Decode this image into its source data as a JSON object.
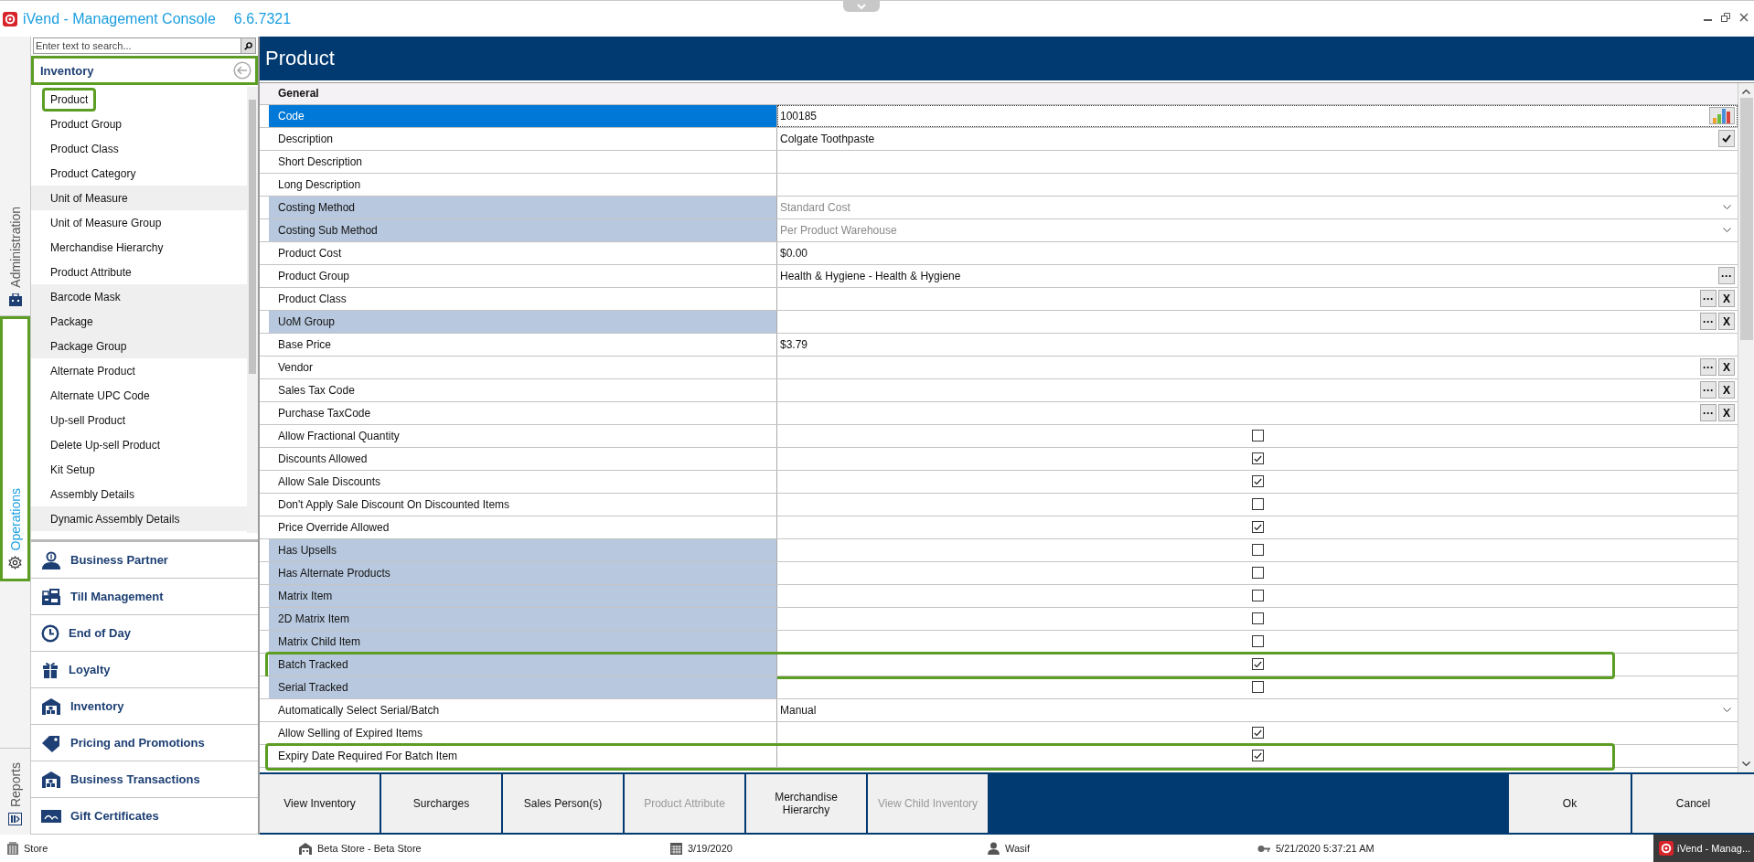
{
  "window": {
    "title": "iVend - Management Console",
    "version": "6.6.7321"
  },
  "side_tabs": [
    {
      "label": "Administration",
      "kind": "briefcase",
      "selected": false,
      "outlined": false
    },
    {
      "label": "Operations",
      "kind": "gear",
      "selected": true,
      "outlined": true
    },
    {
      "label": "Reports",
      "kind": "report",
      "selected": false,
      "outlined": false
    }
  ],
  "navigator": {
    "search": {
      "placeholder": "Enter text to search..."
    },
    "section": {
      "title": "Inventory",
      "outlined": true
    },
    "items": [
      {
        "label": "Product",
        "shaded": false,
        "outlined": true
      },
      {
        "label": "Product Group",
        "shaded": false,
        "outlined": false
      },
      {
        "label": "Product Class",
        "shaded": false,
        "outlined": false
      },
      {
        "label": "Product Category",
        "shaded": false,
        "outlined": false
      },
      {
        "label": "Unit of Measure",
        "shaded": true,
        "outlined": false
      },
      {
        "label": "Unit of Measure Group",
        "shaded": false,
        "outlined": false
      },
      {
        "label": "Merchandise Hierarchy",
        "shaded": false,
        "outlined": false
      },
      {
        "label": "Product Attribute",
        "shaded": false,
        "outlined": false
      },
      {
        "label": "Barcode Mask",
        "shaded": true,
        "outlined": false
      },
      {
        "label": "Package",
        "shaded": true,
        "outlined": false
      },
      {
        "label": "Package Group",
        "shaded": true,
        "outlined": false
      },
      {
        "label": "Alternate Product",
        "shaded": false,
        "outlined": false
      },
      {
        "label": "Alternate UPC Code",
        "shaded": false,
        "outlined": false
      },
      {
        "label": "Up-sell Product",
        "shaded": false,
        "outlined": false
      },
      {
        "label": "Delete Up-sell Product",
        "shaded": false,
        "outlined": false
      },
      {
        "label": "Kit Setup",
        "shaded": false,
        "outlined": false
      },
      {
        "label": "Assembly Details",
        "shaded": false,
        "outlined": false
      },
      {
        "label": "Dynamic Assembly Details",
        "shaded": true,
        "outlined": false
      }
    ]
  },
  "modules": [
    {
      "label": "Business Partner",
      "kind": "partner"
    },
    {
      "label": "Till Management",
      "kind": "register"
    },
    {
      "label": "End of Day",
      "kind": "clock"
    },
    {
      "label": "Loyalty",
      "kind": "gift"
    },
    {
      "label": "Inventory",
      "kind": "warehouse"
    },
    {
      "label": "Pricing and Promotions",
      "kind": "tag"
    },
    {
      "label": "Business Transactions",
      "kind": "warehouse"
    },
    {
      "label": "Gift Certificates",
      "kind": "card"
    }
  ],
  "form": {
    "title": "Product",
    "group": "General",
    "rows": [
      {
        "label": "Code",
        "kind": "text",
        "value": "100185",
        "selected": true,
        "disabled": false,
        "outlined": false,
        "buttons": [
          {
            "kind": "chart"
          }
        ]
      },
      {
        "label": "Description",
        "kind": "text",
        "value": "Colgate Toothpaste",
        "selected": false,
        "disabled": false,
        "outlined": false,
        "buttons": [
          {
            "kind": "check"
          }
        ]
      },
      {
        "label": "Short Description",
        "kind": "text",
        "selected": false,
        "disabled": false,
        "outlined": false
      },
      {
        "label": "Long Description",
        "kind": "text",
        "selected": false,
        "disabled": false,
        "outlined": false
      },
      {
        "label": "Costing Method",
        "kind": "dropdown",
        "value": "Standard Cost",
        "selected": false,
        "disabled": true,
        "outlined": false
      },
      {
        "label": "Costing Sub Method",
        "kind": "dropdown",
        "value": "Per Product Warehouse",
        "selected": false,
        "disabled": true,
        "outlined": false
      },
      {
        "label": "Product Cost",
        "kind": "text",
        "value": "$0.00",
        "selected": false,
        "disabled": false,
        "outlined": false
      },
      {
        "label": "Product Group",
        "kind": "text",
        "value": "Health & Hygiene - Health & Hygiene",
        "selected": false,
        "disabled": false,
        "outlined": false,
        "buttons": [
          {
            "kind": "text",
            "label": "···"
          }
        ]
      },
      {
        "label": "Product Class",
        "kind": "text",
        "selected": false,
        "disabled": false,
        "outlined": false,
        "buttons": [
          {
            "kind": "text",
            "label": "···"
          },
          {
            "kind": "text",
            "label": "X"
          }
        ]
      },
      {
        "label": "UoM Group",
        "kind": "text",
        "selected": false,
        "disabled": true,
        "outlined": false,
        "buttons": [
          {
            "kind": "text",
            "label": "···"
          },
          {
            "kind": "text",
            "label": "X"
          }
        ]
      },
      {
        "label": "Base Price",
        "kind": "text",
        "value": "$3.79",
        "selected": false,
        "disabled": false,
        "outlined": false
      },
      {
        "label": "Vendor",
        "kind": "text",
        "selected": false,
        "disabled": false,
        "outlined": false,
        "buttons": [
          {
            "kind": "text",
            "label": "···"
          },
          {
            "kind": "text",
            "label": "X"
          }
        ]
      },
      {
        "label": "Sales Tax Code",
        "kind": "text",
        "selected": false,
        "disabled": false,
        "outlined": false,
        "buttons": [
          {
            "kind": "text",
            "label": "···"
          },
          {
            "kind": "text",
            "label": "X"
          }
        ]
      },
      {
        "label": "Purchase TaxCode",
        "kind": "text",
        "selected": false,
        "disabled": false,
        "outlined": false,
        "buttons": [
          {
            "kind": "text",
            "label": "···"
          },
          {
            "kind": "text",
            "label": "X"
          }
        ]
      },
      {
        "label": "Allow Fractional Quantity",
        "kind": "checkbox",
        "checked": false,
        "selected": false,
        "disabled": false,
        "outlined": false
      },
      {
        "label": "Discounts Allowed",
        "kind": "checkbox",
        "checked": true,
        "selected": false,
        "disabled": false,
        "outlined": false
      },
      {
        "label": "Allow Sale Discounts",
        "kind": "checkbox",
        "checked": true,
        "selected": false,
        "disabled": false,
        "outlined": false
      },
      {
        "label": "Don't Apply Sale Discount On Discounted Items",
        "kind": "checkbox",
        "checked": false,
        "selected": false,
        "disabled": false,
        "outlined": false
      },
      {
        "label": "Price Override Allowed",
        "kind": "checkbox",
        "checked": true,
        "selected": false,
        "disabled": false,
        "outlined": false
      },
      {
        "label": "Has Upsells",
        "kind": "checkbox",
        "checked": false,
        "selected": false,
        "disabled": true,
        "outlined": false
      },
      {
        "label": "Has Alternate Products",
        "kind": "checkbox",
        "checked": false,
        "selected": false,
        "disabled": true,
        "outlined": false
      },
      {
        "label": "Matrix Item",
        "kind": "checkbox",
        "checked": false,
        "selected": false,
        "disabled": true,
        "outlined": false
      },
      {
        "label": "2D Matrix Item",
        "kind": "checkbox",
        "checked": false,
        "selected": false,
        "disabled": true,
        "outlined": false
      },
      {
        "label": "Matrix Child Item",
        "kind": "checkbox",
        "checked": false,
        "selected": false,
        "disabled": true,
        "outlined": false
      },
      {
        "label": "Batch Tracked",
        "kind": "checkbox",
        "checked": true,
        "selected": false,
        "disabled": true,
        "outlined": true
      },
      {
        "label": "Serial Tracked",
        "kind": "checkbox",
        "checked": false,
        "selected": false,
        "disabled": true,
        "outlined": false
      },
      {
        "label": "Automatically Select Serial/Batch",
        "kind": "dropdown",
        "value": "Manual",
        "selected": false,
        "disabled": false,
        "outlined": false
      },
      {
        "label": "Allow Selling of Expired Items",
        "kind": "checkbox",
        "checked": true,
        "selected": false,
        "disabled": false,
        "outlined": false
      },
      {
        "label": "Expiry Date Required For Batch Item",
        "kind": "checkbox",
        "checked": true,
        "selected": false,
        "disabled": false,
        "outlined": true
      }
    ]
  },
  "actions": [
    {
      "label": "View Inventory",
      "disabled": false
    },
    {
      "label": "Surcharges",
      "disabled": false
    },
    {
      "label": "Sales Person(s)",
      "disabled": false
    },
    {
      "label": "Product Attribute",
      "disabled": true
    },
    {
      "label": "Merchandise Hierarchy",
      "disabled": false
    },
    {
      "label": "View Child Inventory",
      "disabled": true
    }
  ],
  "dialog_buttons": [
    "Ok",
    "Cancel"
  ],
  "status_bar": [
    {
      "kind": "building",
      "text": "Store"
    },
    {
      "kind": "store",
      "text": "Beta Store - Beta Store"
    },
    {
      "kind": "calendar",
      "text": "3/19/2020"
    },
    {
      "kind": "user",
      "text": "Wasif"
    },
    {
      "kind": "key",
      "text": "5/21/2020 5:37:21 AM"
    }
  ],
  "taskbar": {
    "label": "iVend - Manag..."
  }
}
